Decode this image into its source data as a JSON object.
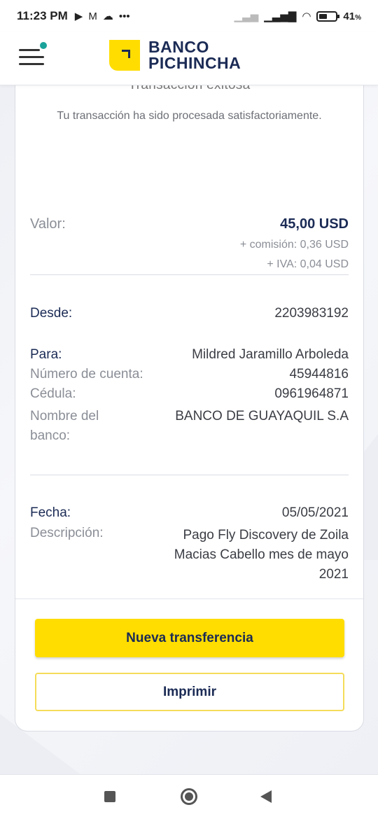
{
  "status_bar": {
    "time": "11:23 PM",
    "battery_percent": "41",
    "battery_unit": "%",
    "icons_left": [
      "play-icon",
      "mail-icon",
      "cloud-icon",
      "more-dots-icon"
    ],
    "icons_right": [
      "signal-weak-icon",
      "signal-icon",
      "wifi-icon",
      "battery-icon"
    ]
  },
  "header": {
    "logo_line1": "BANCO",
    "logo_line2": "PICHINCHA",
    "menu_icon": "hamburger-menu-icon",
    "notification_color": "#1aa39a"
  },
  "receipt": {
    "title": "Transacción exitosa",
    "subtitle": "Tu transacción ha sido procesada satisfactoriamente.",
    "valor_label": "Valor:",
    "valor_amount": "45,00 USD",
    "comision": "+ comisión: 0,36 USD",
    "iva": "+ IVA: 0,04 USD",
    "desde_label": "Desde:",
    "desde_value": "2203983192",
    "para_label": "Para:",
    "para_value": "Mildred Jaramillo Arboleda",
    "cuenta_label": "Número de cuenta:",
    "cuenta_value": "45944816",
    "cedula_label": "Cédula:",
    "cedula_value": "0961964871",
    "banco_label_1": "Nombre del",
    "banco_label_2": "banco:",
    "banco_value": "BANCO DE GUAYAQUIL S.A",
    "fecha_label": "Fecha:",
    "fecha_value": "05/05/2021",
    "descripcion_label": "Descripción:",
    "descripcion_line1": "Pago Fly Discovery de Zoila",
    "descripcion_line2": "Macias Cabello mes de mayo",
    "descripcion_line3": "2021"
  },
  "actions": {
    "new_transfer": "Nueva transferencia",
    "print": "Imprimir"
  },
  "colors": {
    "brand_yellow": "#ffdd00",
    "brand_navy": "#1b2b55"
  }
}
